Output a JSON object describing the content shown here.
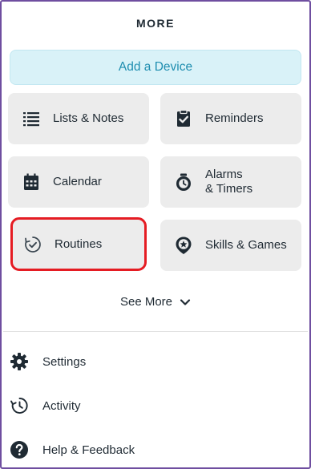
{
  "header": {
    "title": "MORE"
  },
  "add_device": {
    "label": "Add a Device"
  },
  "tiles": [
    {
      "label": "Lists & Notes",
      "icon": "list-icon"
    },
    {
      "label": "Reminders",
      "icon": "clipboard-check-icon"
    },
    {
      "label": "Calendar",
      "icon": "calendar-icon"
    },
    {
      "label_line1": "Alarms",
      "label_line2": "& Timers",
      "icon": "alarm-clock-icon"
    },
    {
      "label": "Routines",
      "icon": "routine-check-icon",
      "highlighted": true
    },
    {
      "label": "Skills & Games",
      "icon": "skills-star-icon"
    }
  ],
  "see_more": {
    "label": "See More",
    "icon": "chevron-down-icon"
  },
  "menu": [
    {
      "label": "Settings",
      "icon": "gear-icon"
    },
    {
      "label": "Activity",
      "icon": "history-clock-icon"
    },
    {
      "label": "Help & Feedback",
      "icon": "help-icon"
    }
  ],
  "colors": {
    "frame_border": "#6f4ea0",
    "add_device_bg": "#d9f2f8",
    "add_device_text": "#1f8eb0",
    "tile_bg": "#ececec",
    "highlight": "#e51c23",
    "text": "#1f2a33"
  }
}
